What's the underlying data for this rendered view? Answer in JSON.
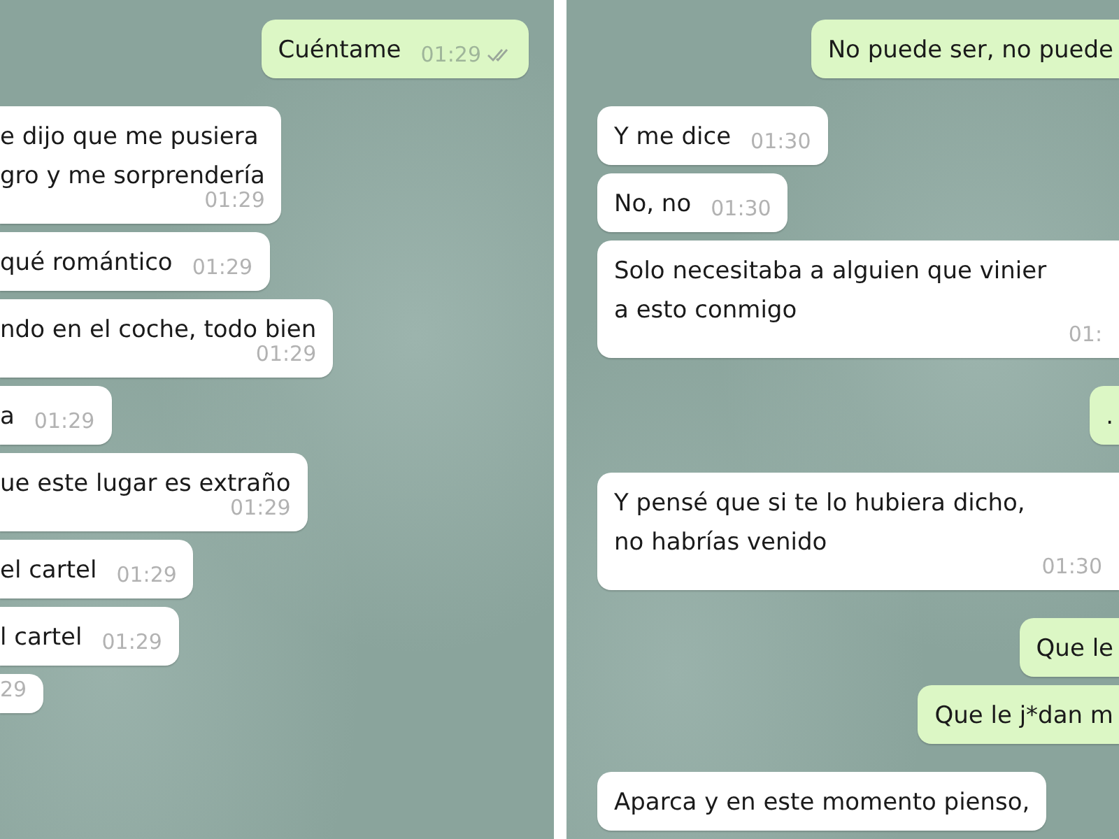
{
  "panels": [
    {
      "messages": [
        {
          "outgoing": true,
          "kind": "inline",
          "text": "Cuéntame",
          "time": "01:29",
          "read": true
        },
        {
          "outgoing": false,
          "kind": "stacked",
          "text": "e dijo que me pusiera\ngro y me sorprendería",
          "time": "01:29"
        },
        {
          "outgoing": false,
          "kind": "inline",
          "text": "qué romántico",
          "time": "01:29"
        },
        {
          "outgoing": false,
          "kind": "stacked",
          "text": "ndo en el coche, todo bien",
          "time": "01:29"
        },
        {
          "outgoing": false,
          "kind": "inline",
          "text": "a",
          "time": "01:29"
        },
        {
          "outgoing": false,
          "kind": "stacked",
          "text": "ue este lugar es extraño",
          "time": "01:29"
        },
        {
          "outgoing": false,
          "kind": "inline",
          "text": "el cartel",
          "time": "01:29"
        },
        {
          "outgoing": false,
          "kind": "inline",
          "text": "l cartel",
          "time": "01:29"
        },
        {
          "outgoing": false,
          "kind": "stacked",
          "time": "29"
        }
      ]
    },
    {
      "messages": [
        {
          "outgoing": true,
          "kind": "inline",
          "text": "No puede ser, no puede"
        },
        {
          "outgoing": false,
          "kind": "inline",
          "text": "Y me dice",
          "time": "01:30"
        },
        {
          "outgoing": false,
          "kind": "inline",
          "text": "No, no",
          "time": "01:30"
        },
        {
          "outgoing": false,
          "kind": "stacked",
          "text": "Solo necesitaba a alguien que vinier\na esto conmigo",
          "time": "01:"
        },
        {
          "outgoing": true,
          "kind": "inline",
          "text": "."
        },
        {
          "outgoing": false,
          "kind": "stacked",
          "text": "Y pensé que si te lo hubiera dicho,\nno habrías venido",
          "time": "01:30"
        },
        {
          "outgoing": true,
          "kind": "inline",
          "text": "Que le"
        },
        {
          "outgoing": true,
          "kind": "inline",
          "text": "Que le j*dan m"
        },
        {
          "outgoing": false,
          "kind": "inline",
          "text": "Aparca y en este momento pienso,"
        }
      ]
    }
  ]
}
